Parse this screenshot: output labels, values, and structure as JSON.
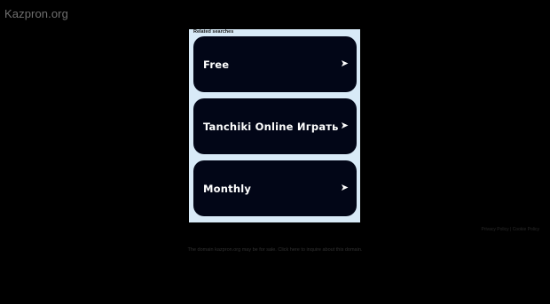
{
  "site": {
    "title": "Kazpron.org"
  },
  "related": {
    "heading": "Related searches",
    "items": [
      {
        "label": "Free",
        "icon": "arrow-right-icon"
      },
      {
        "label": "Tanchiki Online Играть",
        "icon": "arrow-right-icon"
      },
      {
        "label": "Monthly",
        "icon": "arrow-right-icon"
      }
    ]
  },
  "footer": {
    "privacy": "Privacy Policy | Cookie Policy",
    "note": "The domain kazpron.org may be for sale. Click here to inquire about this domain."
  },
  "colors": {
    "background": "#000000",
    "panel": "#d8eaf7",
    "button": "#020617",
    "text": "#ffffff"
  }
}
